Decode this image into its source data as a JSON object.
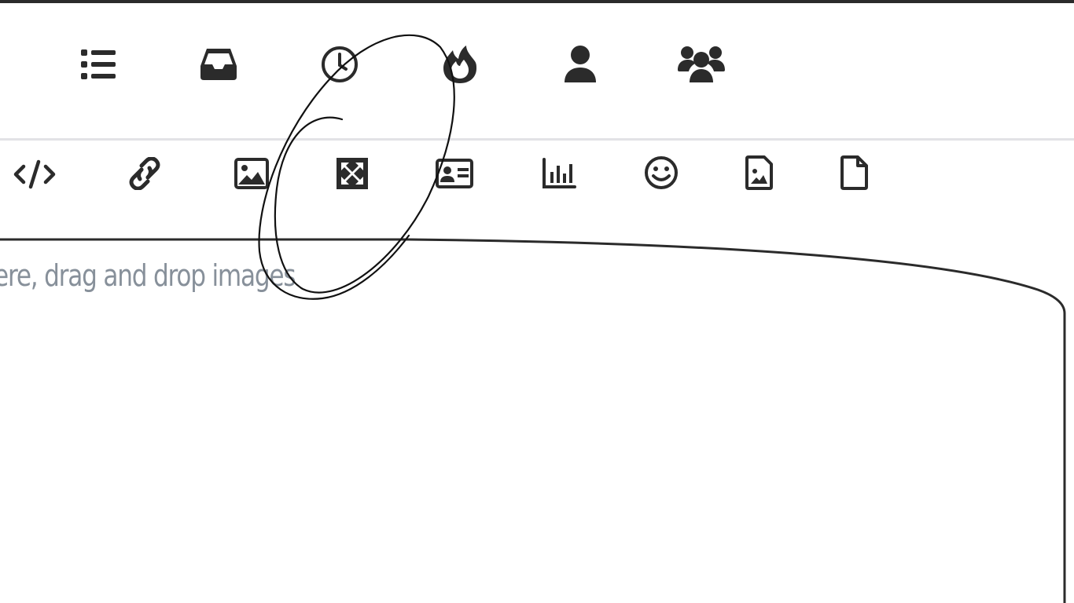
{
  "nav_icons": [
    {
      "name": "list-icon"
    },
    {
      "name": "inbox-icon"
    },
    {
      "name": "clock-icon"
    },
    {
      "name": "fire-icon"
    },
    {
      "name": "user-icon"
    },
    {
      "name": "users-icon"
    }
  ],
  "toolbar_icons": [
    {
      "name": "code-icon"
    },
    {
      "name": "link-icon"
    },
    {
      "name": "image-icon"
    },
    {
      "name": "expand-icon"
    },
    {
      "name": "id-card-icon"
    },
    {
      "name": "chart-icon"
    },
    {
      "name": "smile-icon"
    },
    {
      "name": "file-image-icon"
    },
    {
      "name": "file-icon"
    }
  ],
  "editor": {
    "placeholder": "ere, drag and drop images"
  },
  "colors": {
    "icon": "#2b2b2b",
    "placeholder": "#87909a",
    "divider": "#e2e2e6"
  }
}
